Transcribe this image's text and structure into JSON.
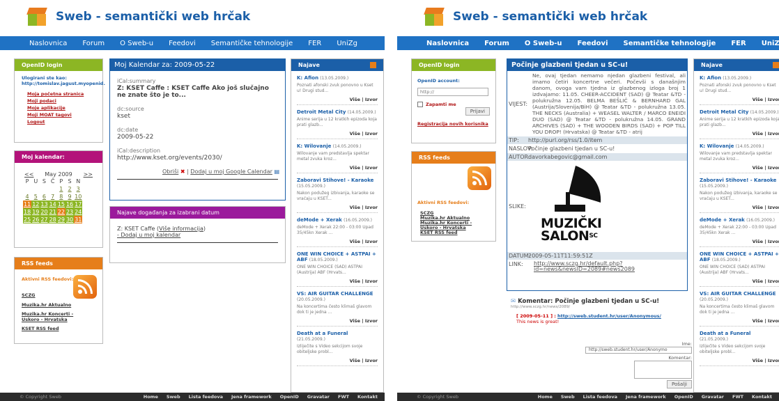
{
  "site": {
    "title": "Sweb - semantički web hrčak"
  },
  "nav": [
    "Naslovnica",
    "Forum",
    "O Sweb-u",
    "Feedovi",
    "Semantičke tehnologije",
    "FER",
    "UniZg"
  ],
  "footer": {
    "copyright": "© Copyright Sweb",
    "links": [
      "Home",
      "Sweb",
      "Lista feedova",
      "Jena framework",
      "OpenID",
      "Gravatar",
      "FWT",
      "Kontakt"
    ]
  },
  "left": {
    "openid": {
      "title": "OpenID login",
      "logged_label": "Ulogirani ste kao:",
      "logged_user": "http://tomislav.jagust.myopenid.",
      "links": [
        "Moja početna stranica",
        "Moji podaci",
        "Moje aplikacije",
        "Moji MOAT tagovi",
        "Logout"
      ]
    },
    "calendar": {
      "title": "Moj kalendar:",
      "prev": "<<",
      "month": "May 2009",
      "next": ">>",
      "days": [
        "P",
        "U",
        "S",
        "Č",
        "P",
        "S",
        "N"
      ],
      "weeks": [
        [
          "",
          "",
          "",
          "",
          "1",
          "2",
          "3"
        ],
        [
          "4",
          "5",
          "6",
          "7",
          "8",
          "9",
          "10"
        ],
        [
          "11",
          "12",
          "13",
          "14",
          "15",
          "16",
          "17"
        ],
        [
          "18",
          "19",
          "20",
          "21",
          "22",
          "23",
          "24"
        ],
        [
          "25",
          "26",
          "27",
          "28",
          "29",
          "30",
          "31"
        ]
      ]
    },
    "rss": {
      "title": "RSS feeds",
      "active": "Aktivni RSS feedovi:",
      "feeds": [
        "SCZG",
        "Muzika.hr Aktualno",
        "Muzika.hr Koncerti - Uskoro - Hrvatska",
        "KSET RSS feed"
      ]
    },
    "main": {
      "title": "Moj Kalendar za: 2009-05-22",
      "summary_k": "iCal:summary",
      "summary_v": "Z: KSET Caffe : KSET Caffe Ako još slučajno ne znate što je to...",
      "source_k": "dc:source",
      "source_v": "kset",
      "date_k": "dc:date",
      "date_v": "2009-05-22",
      "desc_k": "iCal:description",
      "desc_v": "http://www.kset.org/events/2030/",
      "delete": "Obriši",
      "addgoogle": "Dodaj u moj Google Calendar"
    },
    "events": {
      "title": "Najave događanja za izabrani datum",
      "item": "Z: KSET Caffe",
      "more": "Više informacija",
      "add": "- Dodaj u moj kalendar"
    }
  },
  "news": {
    "title": "Najave",
    "items": [
      {
        "t": "K: Afion",
        "d": "(13.05.2009.)",
        "x": "Poznati afonski zvuk ponovno u Kset u! Drugi stud..."
      },
      {
        "t": "Detroit Metal City",
        "d": "(14.05.2009.)",
        "x": "Anime serija u 12 kratkih epizoda koja prati glazb..."
      },
      {
        "t": "K: Wilovanje",
        "d": "(14.05.2009.)",
        "x": "Wilovanje vam predstavlja spektar metal zvuka kroz..."
      },
      {
        "t": "Zaboravi Stihove! - Karaoke",
        "d": "(15.05.2009.)",
        "x": "Nakon podužeg izbivanja, karaoke se vraćaju u KSET..."
      },
      {
        "t": "deMode + Xerak",
        "d": "(16.05.2009.)",
        "x": "deMode + Xerak 22:00 - 03:00 Upad 35/45kn Xerak ..."
      },
      {
        "t": "ONE WIN CHOICE + ASTPAI + ABF",
        "d": "(18.05.2009.)",
        "x": "ONE WIN CHOICE (SAD) ASTPAI (Austrija) ABF (Hrvats..."
      },
      {
        "t": "VS: AIR GUITAR CHALLENGE",
        "d": "(20.05.2009.)",
        "x": "Na koncertima često klimaš glavom dok ti je jedna ..."
      },
      {
        "t": "Death at a Funeral",
        "d": "(21.05.2009.)",
        "x": "Izliječite s Video sekcijom svoje obiteljske probl..."
      }
    ],
    "more": "Više | Izvor"
  },
  "right": {
    "openid": {
      "title": "OpenID login",
      "account": "OpenID account:",
      "placeholder": "http://",
      "remember": "Zapamti me",
      "submit": "Prijavi",
      "register": "Registracija novih korisnika"
    },
    "rss": {
      "title": "RSS feeds",
      "active": "Aktivni RSS feedovi:",
      "feeds": [
        "SCZG",
        "Muzika.hr Aktualno",
        "Muzika.hr Koncerti - Uskoro - Hrvatska",
        "KSET RSS feed"
      ]
    },
    "main": {
      "title": "Počinje glazbeni tjedan u SC-u!",
      "vijest_k": "VIJEST:",
      "vijest_v": "Ne, ovaj tjedan nemamo njedan glazbeni festival, ali imamo četiri koncertne večeri. Počevši s današnjim danom, ovoga vam tjedna iz glazbenog izloga broj 1 izdvajamo: 11.05. CHEER-ACCIDENT (SAD) @ Teatar &TD - polukružna 12.05. BELMA BEŠLIĆ & BERNHARD GAL (Austrija/Slovenija/BiH) @ Teatar &TD - polukružna 13.05. THE NECKS (Australia) + WEASEL WALTER / MARCO ENEIDI DUO (SAD) @ Teatar &TD - polukružna 14.05. GRAND ARCHIVES (SAD) + THE WOODEN BIRDS (SAD) + POP TILL YOU DROP! (Hrvatska) @ Teatar &TD - atrij",
      "tip_k": "TIP:",
      "tip_v": "http://purl.org/rss/1.0/item",
      "naslov_k": "NASLOV:",
      "naslov_v": "Počinje glazbeni tjedan u SC-u!",
      "autor_k": "AUTOR:",
      "autor_v": "davorkabegovic@gmail.com",
      "slika_k": "SLIKE:",
      "logo_1": "MUZIČKI",
      "logo_2": "SALON",
      "logo_sup": "SC",
      "datum_k": "DATUM:",
      "datum_v": "2009-05-11T11:59:51Z",
      "link_k": "LINK:",
      "link_v": "http://www.sczg.hr/default.php?id=news&newsID=2089#news2089",
      "comment_title": "Komentar: Počinje glazbeni tjedan u SC-u!",
      "comment_url": "http://www.sczg.hr/news/2089/",
      "comment_date": "[ 2009-05-11 ] :",
      "comment_user": "http://sweb.student.hr/user/Anonymous/",
      "comment_text": "This news is great!",
      "ime_label": "Ime:",
      "ime_value": "http://sweb.student.hr/user/Anonymo",
      "komentar_label": "Komentar:",
      "send": "Pošalji"
    }
  }
}
